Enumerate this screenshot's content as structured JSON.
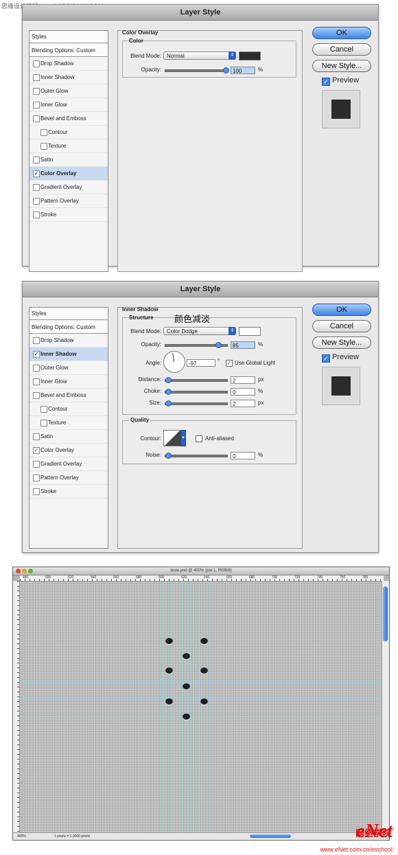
{
  "watermark_top": "思缘设计论坛 www.MISSYUAN.COM",
  "dialog1": {
    "title": "Layer Style",
    "styles_header": "Styles",
    "blending_options": "Blending Options: Custom",
    "items": [
      {
        "label": "Drop Shadow",
        "checked": false
      },
      {
        "label": "Inner Shadow",
        "checked": false
      },
      {
        "label": "Outer Glow",
        "checked": false
      },
      {
        "label": "Inner Glow",
        "checked": false
      },
      {
        "label": "Bevel and Emboss",
        "checked": false
      },
      {
        "label": "Contour",
        "checked": false
      },
      {
        "label": "Texture",
        "checked": false
      },
      {
        "label": "Satin",
        "checked": false
      },
      {
        "label": "Color Overlay",
        "checked": true
      },
      {
        "label": "Gradient Overlay",
        "checked": false
      },
      {
        "label": "Pattern Overlay",
        "checked": false
      },
      {
        "label": "Stroke",
        "checked": false
      }
    ],
    "section_title": "Color Overlay",
    "group_title": "Color",
    "blend_mode_label": "Blend Mode:",
    "blend_mode_value": "Normal",
    "opacity_label": "Opacity:",
    "opacity_value": "100",
    "unit_percent": "%",
    "swatch_color": "#2b2b2b",
    "buttons": {
      "ok": "OK",
      "cancel": "Cancel",
      "new_style": "New Style..."
    },
    "preview_label": "Preview"
  },
  "dialog2": {
    "title": "Layer Style",
    "styles_header": "Styles",
    "blending_options": "Blending Options: Custom",
    "items": [
      {
        "label": "Drop Shadow",
        "checked": false
      },
      {
        "label": "Inner Shadow",
        "checked": true
      },
      {
        "label": "Outer Glow",
        "checked": false
      },
      {
        "label": "Inner Glow",
        "checked": false
      },
      {
        "label": "Bevel and Emboss",
        "checked": false
      },
      {
        "label": "Contour",
        "checked": false
      },
      {
        "label": "Texture",
        "checked": false
      },
      {
        "label": "Satin",
        "checked": false
      },
      {
        "label": "Color Overlay",
        "checked": true
      },
      {
        "label": "Gradient Overlay",
        "checked": false
      },
      {
        "label": "Pattern Overlay",
        "checked": false
      },
      {
        "label": "Stroke",
        "checked": false
      }
    ],
    "section_title": "Inner Shadow",
    "structure_title": "Structure",
    "annotation": "颜色减淡",
    "blend_mode_label": "Blend Mode:",
    "blend_mode_value": "Color Dodge",
    "opacity_label": "Opacity:",
    "opacity_value": "85",
    "angle_label": "Angle:",
    "angle_value": "-97",
    "degree_symbol": "°",
    "use_global_light": "Use Global Light",
    "distance_label": "Distance:",
    "distance_value": "2",
    "choke_label": "Choke:",
    "choke_value": "0",
    "size_label": "Size:",
    "size_value": "2",
    "unit_px": "px",
    "unit_percent": "%",
    "quality_title": "Quality",
    "contour_label": "Contour:",
    "anti_aliased": "Anti-aliased",
    "noise_label": "Noise:",
    "noise_value": "0",
    "swatch_color": "#ffffff",
    "buttons": {
      "ok": "OK",
      "cancel": "Cancel",
      "new_style": "New Style..."
    },
    "preview_label": "Preview"
  },
  "canvas_window": {
    "title": "teste.psd @ 400% (pat 1, RGB/8)",
    "ruler_marks": [
      "480",
      "500",
      "520",
      "540",
      "560",
      "580",
      "600",
      "620",
      "640",
      "660",
      "680",
      "700",
      "720",
      "740",
      "760",
      "780"
    ],
    "zoom": "400%",
    "doc_info": "1 pixels = 1.0000 pixels"
  },
  "brand": {
    "logo": "eNet",
    "logo_cn": "网络学院",
    "url": "www.eNet.com.cn/eschool"
  }
}
